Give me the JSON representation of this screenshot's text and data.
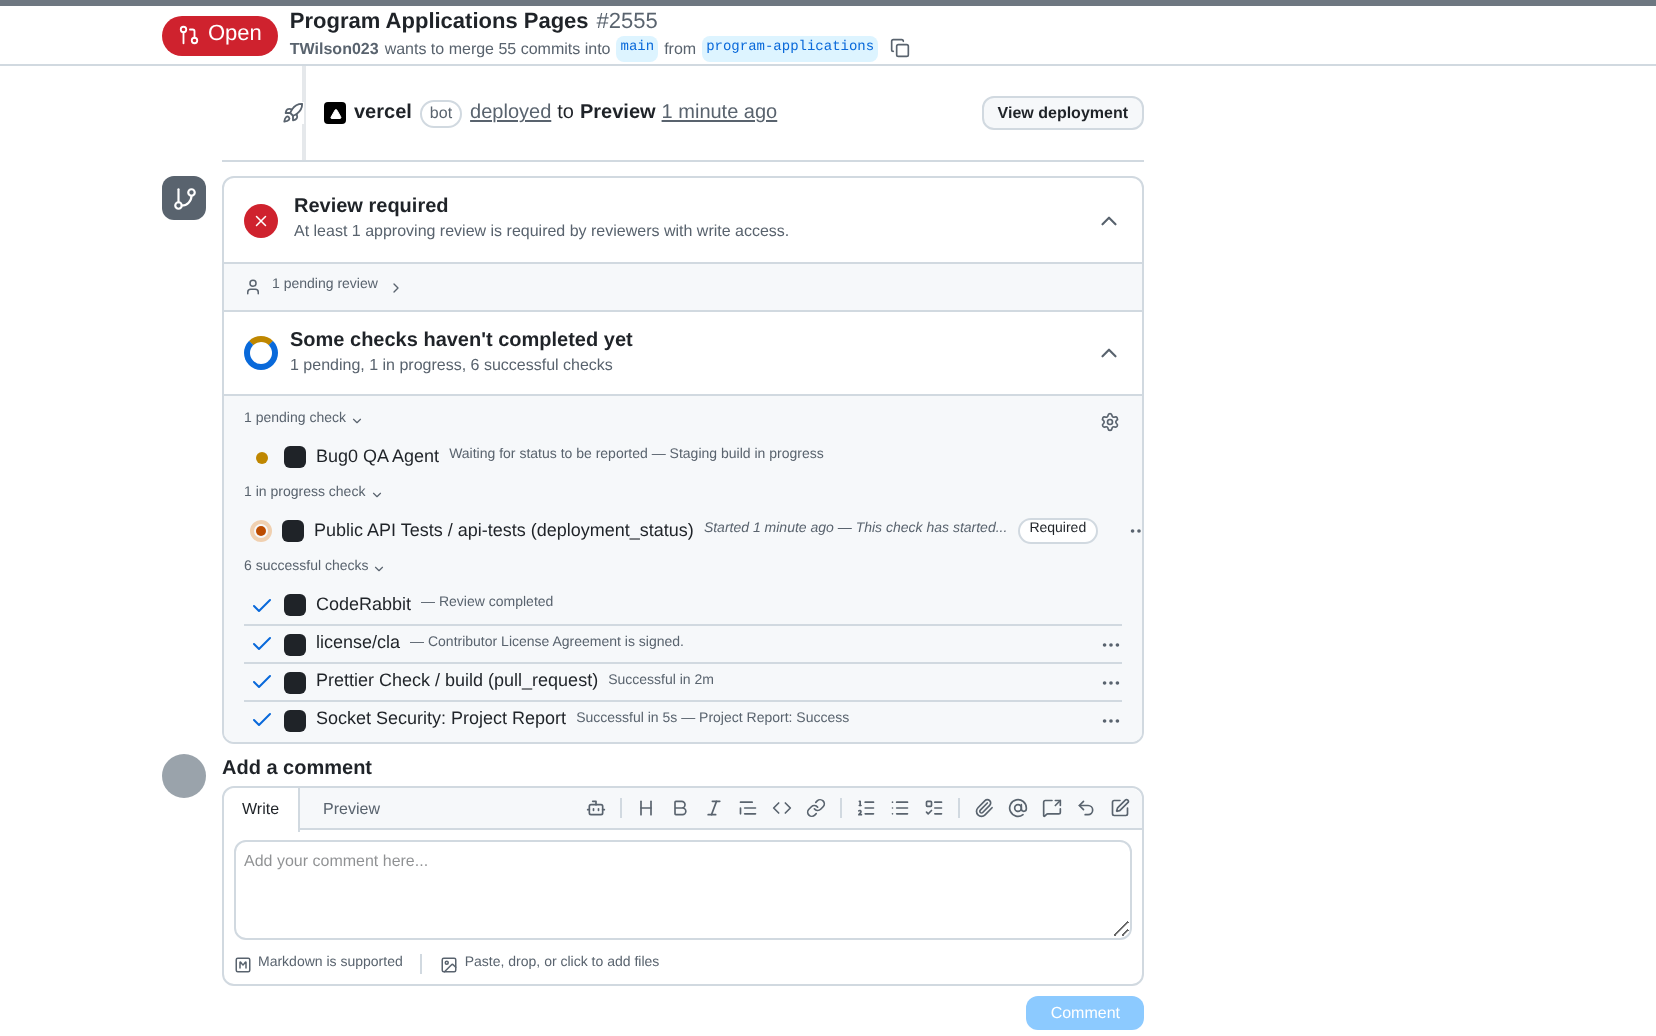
{
  "pull_request": {
    "state": "Open",
    "title": "Program Applications Pages",
    "number": "#2555",
    "author": "TWilson023",
    "summary_1": "wants to merge 55 commits into",
    "base_branch": "main",
    "summary_2": "from",
    "head_branch": "program-applications"
  },
  "deployment": {
    "actor": "vercel",
    "badge": "bot",
    "action": "deployed",
    "to": "to",
    "environment": "Preview",
    "time": "1 minute ago",
    "button": "View deployment"
  },
  "review": {
    "title": "Review required",
    "description": "At least 1 approving review is required by reviewers with write access.",
    "expanded": true,
    "pending": "1 pending review"
  },
  "checks": {
    "title": "Some checks haven't completed yet",
    "summary": "1 pending, 1 in progress, 6 successful checks",
    "expanded": true,
    "groups": [
      {
        "label": "1 pending check",
        "items": [
          {
            "kind": "pending",
            "name": "Bug0 QA Agent",
            "description": "Waiting for status to be reported — Staging build in progress",
            "required": false,
            "menu": false
          }
        ]
      },
      {
        "label": "1 in progress check",
        "items": [
          {
            "kind": "in_progress",
            "name": "Public API Tests / api-tests (deployment_status)",
            "description": "Started 1 minute ago — This check has started...",
            "required": true,
            "required_label": "Required",
            "menu": true
          }
        ]
      },
      {
        "label": "6 successful checks",
        "items": [
          {
            "kind": "success",
            "name": "CodeRabbit",
            "description": "— Review completed",
            "required": false,
            "menu": false
          },
          {
            "kind": "success",
            "name": "license/cla",
            "description": "— Contributor License Agreement is signed.",
            "required": false,
            "menu": true
          },
          {
            "kind": "success",
            "name": "Prettier Check / build (pull_request)",
            "description": "Successful in 2m",
            "required": false,
            "menu": true
          },
          {
            "kind": "success",
            "name": "Socket Security: Project Report",
            "description": "Successful in 5s — Project Report: Success",
            "required": false,
            "menu": true
          }
        ]
      }
    ]
  },
  "comment": {
    "heading": "Add a comment",
    "tabs": [
      {
        "label": "Write",
        "selected": true
      },
      {
        "label": "Preview",
        "selected": false
      }
    ],
    "placeholder": "Add your comment here...",
    "markdown_note": "Markdown is supported",
    "files_note": "Paste, drop, or click to add files",
    "submit": {
      "label": "Comment",
      "disabled": true
    }
  }
}
